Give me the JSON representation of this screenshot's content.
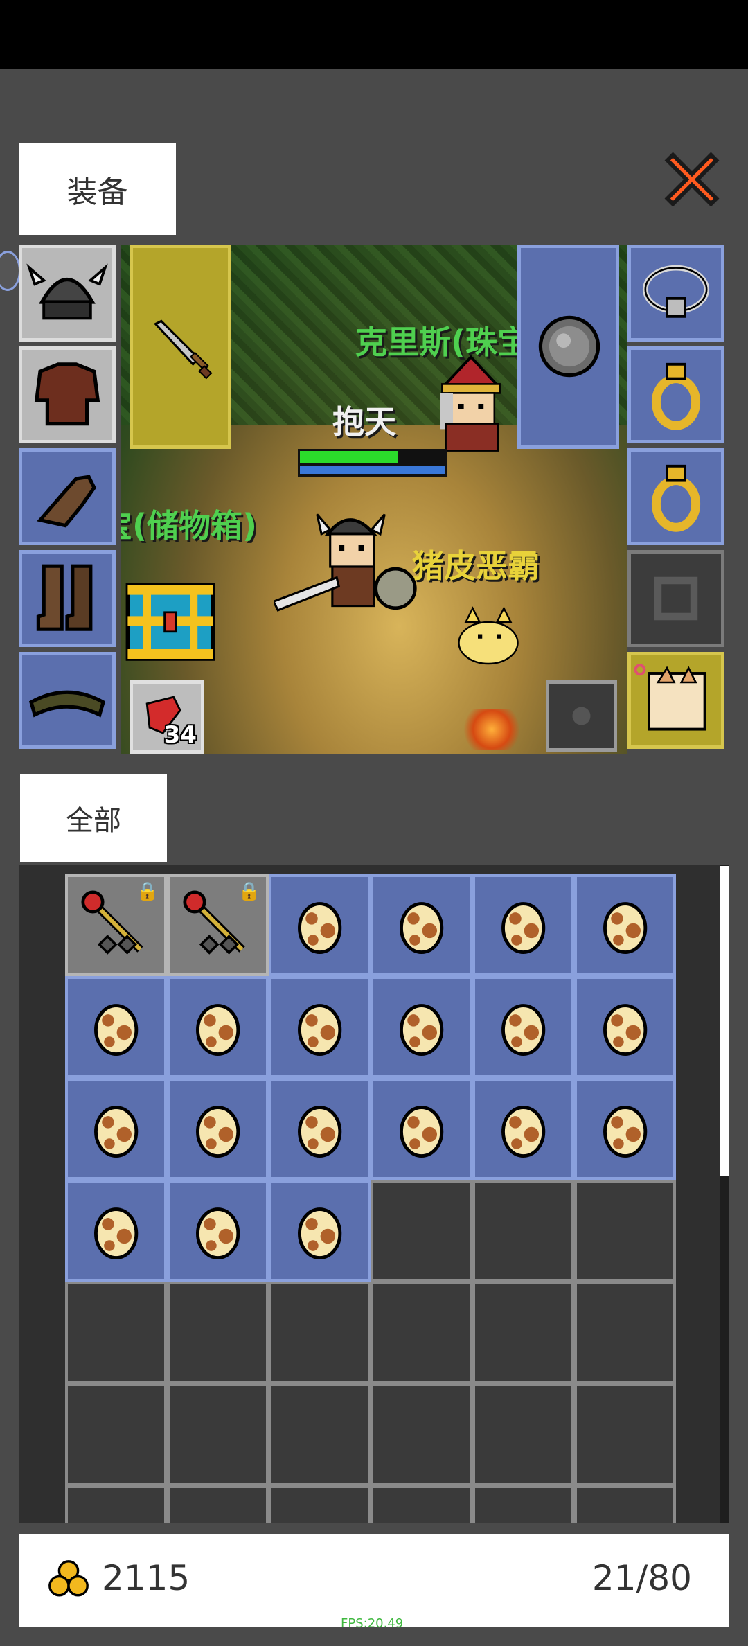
{
  "tabs": {
    "equip": "装备",
    "all": "全部"
  },
  "scene": {
    "npc_name": "克里斯(珠宝",
    "player_name": "抱天",
    "chest_label": "宝(储物箱)",
    "enemy_name": "猪皮恶霸",
    "hp_ratio": 0.68,
    "mp_ratio": 1.0
  },
  "equipment": {
    "left_slots": [
      "helmet-icon",
      "armor-icon",
      "glove-icon",
      "boots-icon",
      "belt-icon"
    ],
    "right_slots": [
      "necklace-icon",
      "ring-icon",
      "ring-icon",
      "locked-slot-icon",
      "pet-icon"
    ],
    "weapon": "sword-icon",
    "shield": "shield-icon",
    "potion_count": "34"
  },
  "inventory": {
    "rows": [
      [
        "wand",
        "wand",
        "egg",
        "egg",
        "egg",
        "egg"
      ],
      [
        "egg",
        "egg",
        "egg",
        "egg",
        "egg",
        "egg"
      ],
      [
        "egg",
        "egg",
        "egg",
        "egg",
        "egg",
        "egg"
      ],
      [
        "egg",
        "egg",
        "egg",
        "empty",
        "empty",
        "empty"
      ],
      [
        "empty",
        "empty",
        "empty",
        "empty",
        "empty",
        "empty"
      ],
      [
        "empty",
        "empty",
        "empty",
        "empty",
        "empty",
        "empty"
      ],
      [
        "empty",
        "empty",
        "empty",
        "empty",
        "empty",
        "empty"
      ]
    ]
  },
  "footer": {
    "gold": "2115",
    "capacity": "21/80"
  },
  "fps_text": "FPS:20.49",
  "colors": {
    "slot_blue": "#5b6fae",
    "slot_yellow": "#b4a52a",
    "name_green": "#4fd04f",
    "enemy_yellow": "#e8d23a"
  }
}
